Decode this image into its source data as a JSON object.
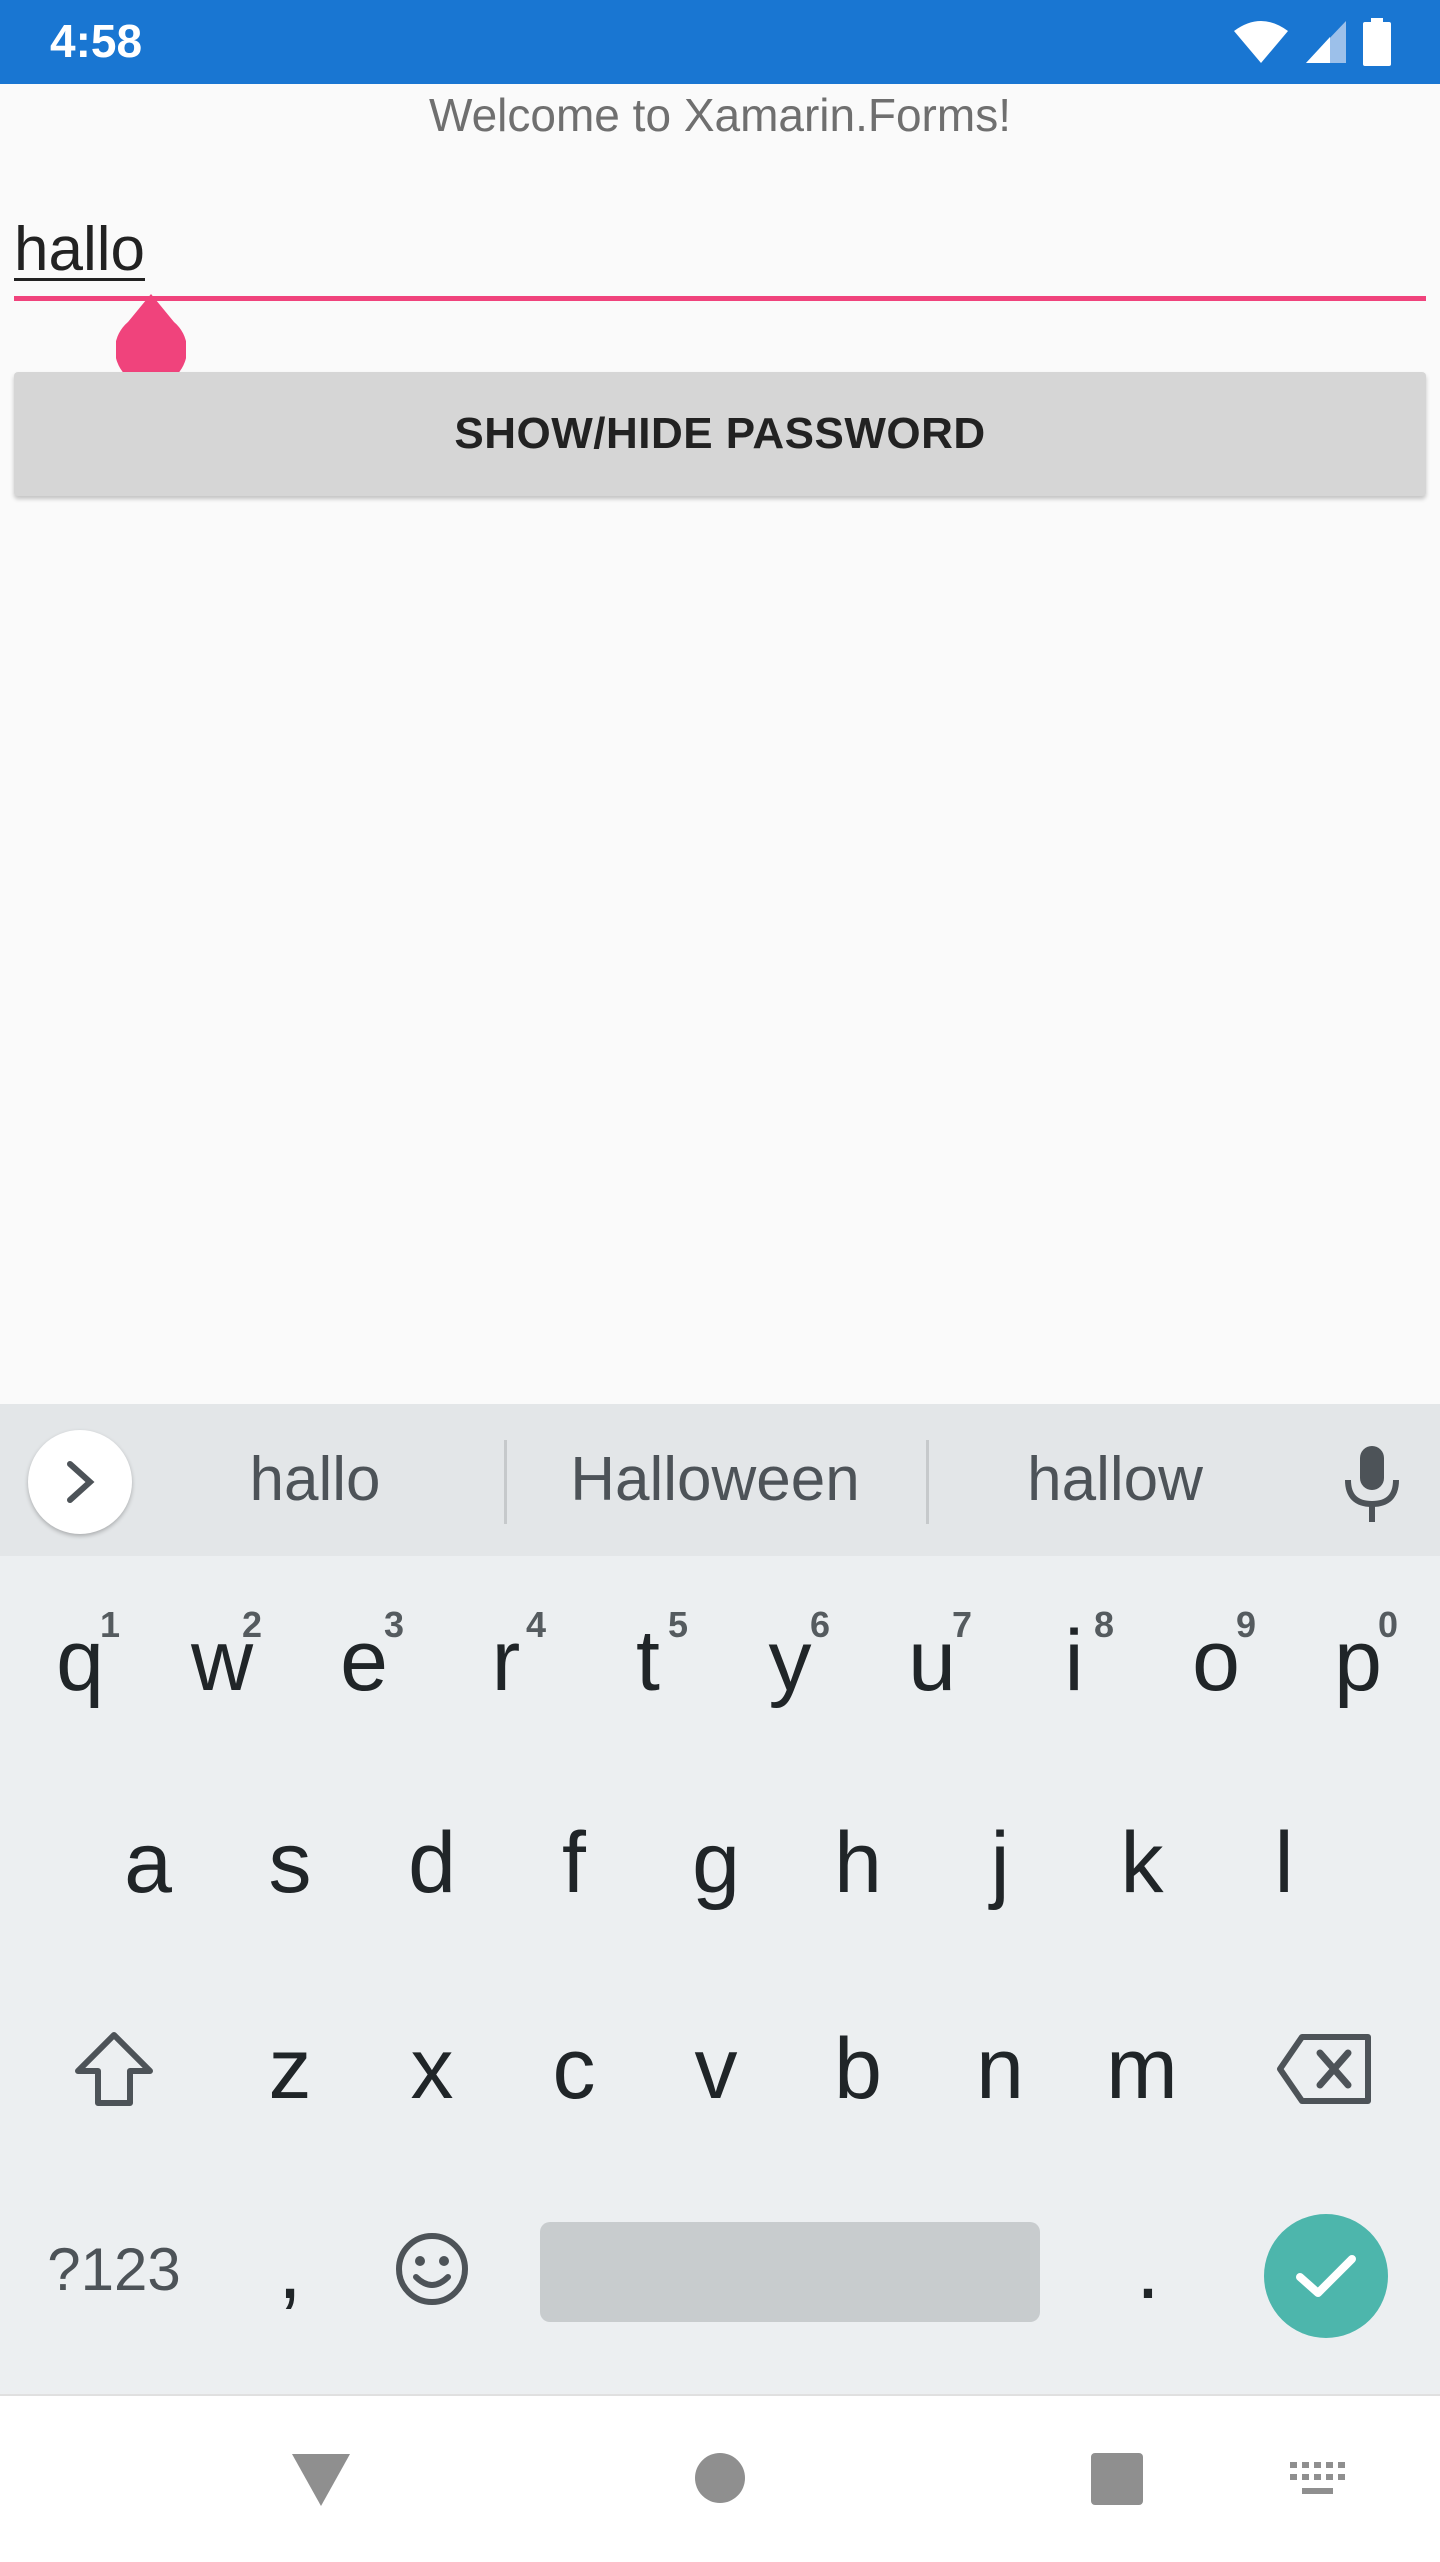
{
  "status_bar": {
    "time": "4:58",
    "icons": [
      "wifi-icon",
      "signal-icon",
      "battery-icon"
    ]
  },
  "app": {
    "welcome_text": "Welcome to Xamarin.Forms!",
    "entry_value": "hallo",
    "show_hide_button_label": "SHOW/HIDE PASSWORD"
  },
  "keyboard": {
    "suggestions": [
      "hallo",
      "Halloween",
      "hallow"
    ],
    "row1": [
      {
        "label": "q",
        "hint": "1"
      },
      {
        "label": "w",
        "hint": "2"
      },
      {
        "label": "e",
        "hint": "3"
      },
      {
        "label": "r",
        "hint": "4"
      },
      {
        "label": "t",
        "hint": "5"
      },
      {
        "label": "y",
        "hint": "6"
      },
      {
        "label": "u",
        "hint": "7"
      },
      {
        "label": "i",
        "hint": "8"
      },
      {
        "label": "o",
        "hint": "9"
      },
      {
        "label": "p",
        "hint": "0"
      }
    ],
    "row2": [
      "a",
      "s",
      "d",
      "f",
      "g",
      "h",
      "j",
      "k",
      "l"
    ],
    "row3": [
      "z",
      "x",
      "c",
      "v",
      "b",
      "n",
      "m"
    ],
    "symbols_label": "?123",
    "comma_label": ",",
    "period_label": "."
  },
  "colors": {
    "status_bar": "#1976d2",
    "accent": "#f0437c",
    "enter_key": "#4db6ac"
  },
  "nav_bar": {
    "icons": [
      "back-icon",
      "home-icon",
      "recents-icon",
      "keyboard-switch-icon"
    ]
  }
}
